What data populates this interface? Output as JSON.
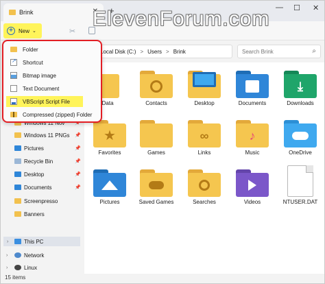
{
  "window": {
    "tab_title": "Brink",
    "watermark": "ElevenForum.com",
    "controls": {
      "minimize": "—",
      "maximize": "☐",
      "close": "✕"
    }
  },
  "commandbar": {
    "new_label": "New",
    "new_caret": "⌄"
  },
  "address": {
    "crumbs": [
      "Local Disk (C:)",
      "Users",
      "Brink"
    ],
    "separator": ">"
  },
  "search": {
    "placeholder": "Search Brink"
  },
  "new_menu": {
    "items": [
      {
        "label": "Folder",
        "icon": "folder-icon"
      },
      {
        "label": "Shortcut",
        "icon": "shortcut-icon"
      },
      {
        "label": "Bitmap image",
        "icon": "bitmap-icon"
      },
      {
        "label": "Text Document",
        "icon": "text-document-icon"
      },
      {
        "label": "VBScript Script File",
        "icon": "vbscript-icon",
        "highlighted": true
      },
      {
        "label": "Compressed (zipped) Folder",
        "icon": "zip-folder-icon"
      }
    ]
  },
  "sidebar": {
    "items": [
      {
        "label": "Windows 11 Nov",
        "pinned": true
      },
      {
        "label": "Windows 11 PNGs",
        "pinned": true
      },
      {
        "label": "Pictures",
        "pinned": true
      },
      {
        "label": "Recycle Bin",
        "pinned": true
      },
      {
        "label": "Desktop",
        "pinned": true
      },
      {
        "label": "Documents",
        "pinned": true
      },
      {
        "label": "Screenpresso",
        "pinned": false
      },
      {
        "label": "Banners",
        "pinned": false
      }
    ],
    "locations": [
      {
        "label": "This PC",
        "selected": true
      },
      {
        "label": "Network",
        "selected": false
      },
      {
        "label": "Linux",
        "selected": false
      }
    ]
  },
  "files": [
    {
      "label": "AppData",
      "icon": "folder-icon"
    },
    {
      "label": "Contacts",
      "icon": "contacts-folder-icon"
    },
    {
      "label": "Desktop",
      "icon": "desktop-folder-icon"
    },
    {
      "label": "Documents",
      "icon": "documents-folder-icon"
    },
    {
      "label": "Downloads",
      "icon": "downloads-folder-icon"
    },
    {
      "label": "Favorites",
      "icon": "favorites-folder-icon"
    },
    {
      "label": "Games",
      "icon": "folder-icon"
    },
    {
      "label": "Links",
      "icon": "links-folder-icon"
    },
    {
      "label": "Music",
      "icon": "music-folder-icon"
    },
    {
      "label": "OneDrive",
      "icon": "onedrive-folder-icon"
    },
    {
      "label": "Pictures",
      "icon": "pictures-folder-icon"
    },
    {
      "label": "Saved Games",
      "icon": "saved-games-folder-icon"
    },
    {
      "label": "Searches",
      "icon": "searches-folder-icon"
    },
    {
      "label": "Videos",
      "icon": "videos-folder-icon"
    },
    {
      "label": "NTUSER.DAT",
      "icon": "file-icon"
    }
  ],
  "status": {
    "count": "15 items"
  }
}
